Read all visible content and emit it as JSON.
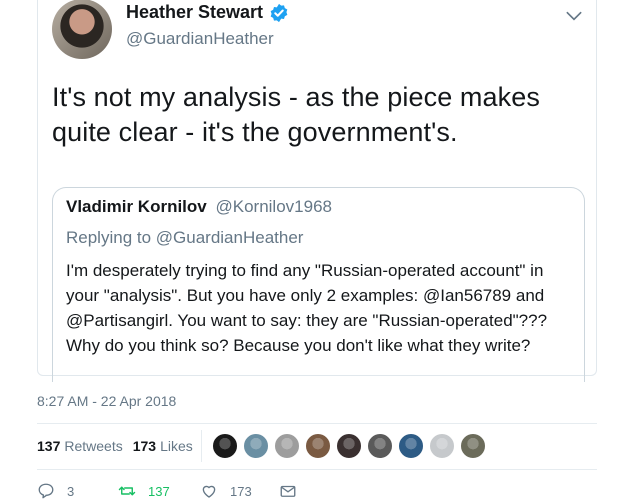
{
  "tweet": {
    "author_name": "Heather Stewart",
    "author_handle": "@GuardianHeather",
    "text": "It's not my analysis - as the piece makes quite clear - it's the government's.",
    "timestamp": "8:27 AM - 22 Apr 2018"
  },
  "quote": {
    "author_name": "Vladimir Kornilov",
    "author_handle": "@Kornilov1968",
    "replying_to": "Replying to @GuardianHeather",
    "text": "I'm desperately trying to find any \"Russian-operated account\" in your \"analysis\". But you have only 2 examples: @Ian56789 and @Partisangirl. You want to say: they are \"Russian-operated\"??? Why do you think so? Because you don't like what they write?"
  },
  "stats": {
    "retweets_count": "137",
    "retweets_label": "Retweets",
    "likes_count": "173",
    "likes_label": "Likes"
  },
  "likers": [
    "#1a1a1a",
    "#6a8fa3",
    "#9d9d9d",
    "#7a5a42",
    "#3a3030",
    "#5a5a5a",
    "#2d5b85",
    "#c6c9cc",
    "#6b6b5a"
  ],
  "actions": {
    "reply_count": "3",
    "retweet_count": "137",
    "like_count": "173"
  },
  "colors": {
    "verified": "#1da1f2",
    "retweet_active": "#17bf63",
    "muted": "#657786"
  }
}
